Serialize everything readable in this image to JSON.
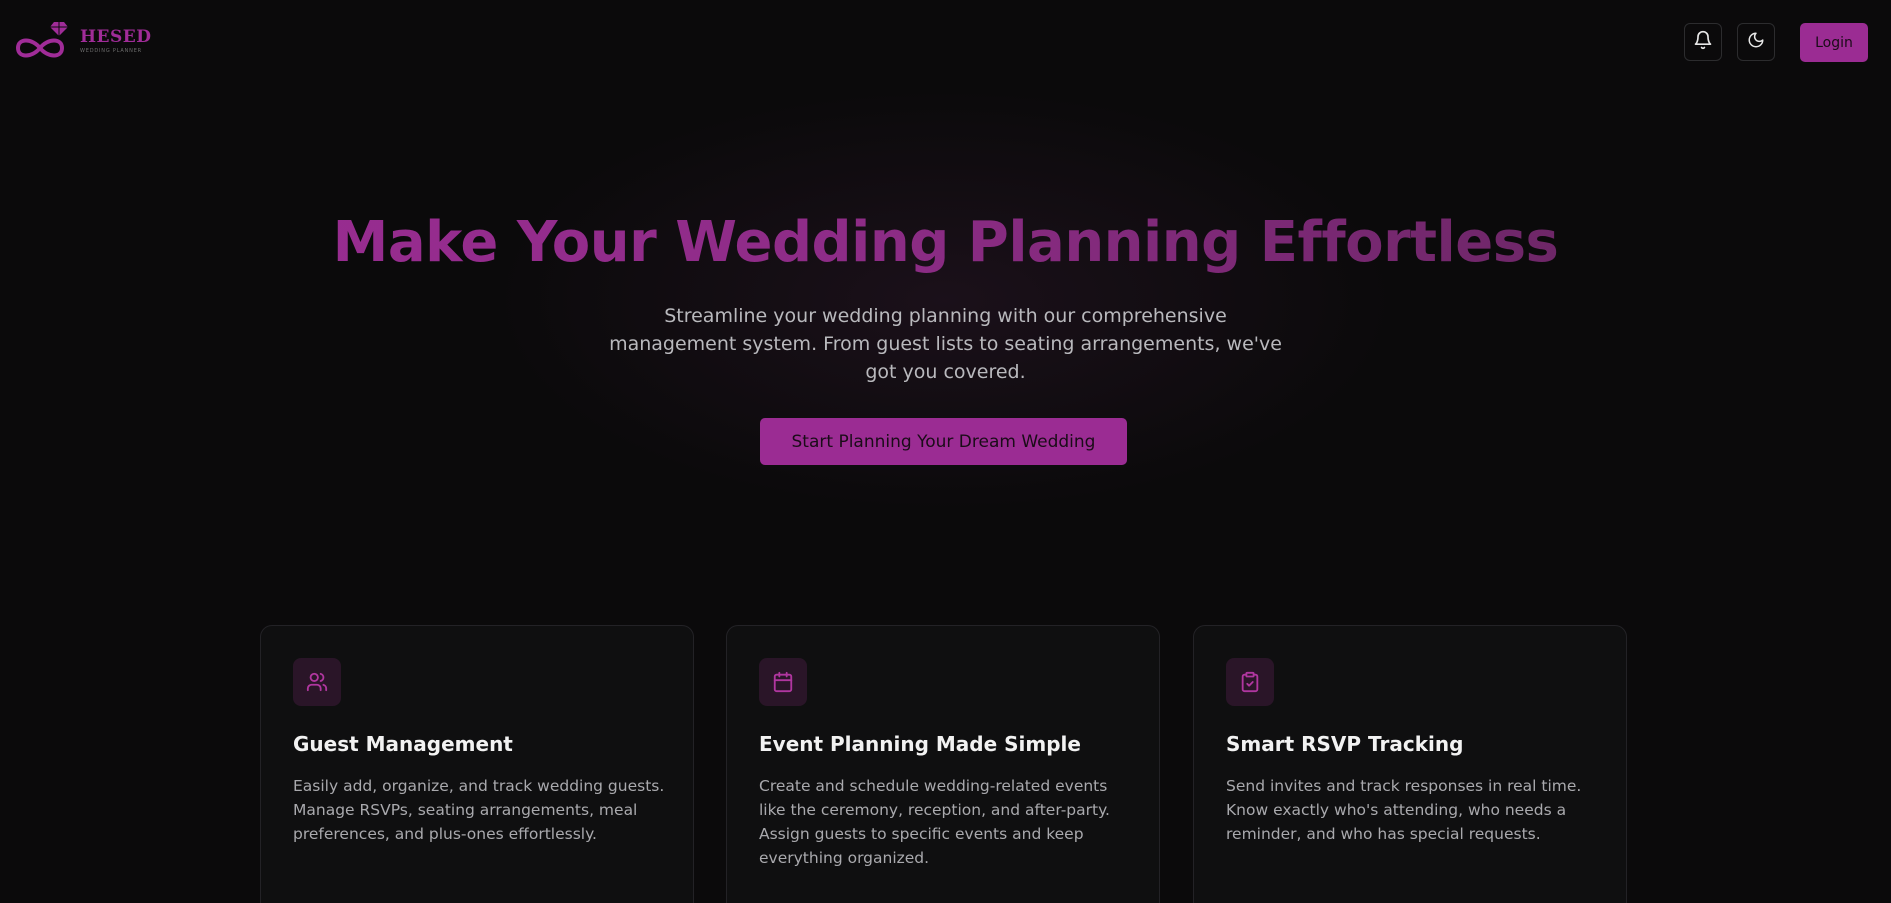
{
  "header": {
    "logo": {
      "name": "HESED",
      "tagline": "WEDDING PLANNER",
      "icon": "infinity-ring-icon"
    },
    "notification_icon": "bell-icon",
    "theme_icon": "moon-icon",
    "login_label": "Login"
  },
  "hero": {
    "title": "Make Your Wedding Planning Effortless",
    "subtitle": "Streamline your wedding planning with our comprehensive management system. From guest lists to seating arrangements, we've got you covered.",
    "cta_label": "Start Planning Your Dream Wedding"
  },
  "features": [
    {
      "icon": "users-icon",
      "title": "Guest Management",
      "description": "Easily add, organize, and track wedding guests. Manage RSVPs, seating arrangements, meal preferences, and plus-ones effortlessly."
    },
    {
      "icon": "calendar-icon",
      "title": "Event Planning Made Simple",
      "description": "Create and schedule wedding-related events like the ceremony, reception, and after-party. Assign guests to specific events and keep everything organized."
    },
    {
      "icon": "clipboard-check-icon",
      "title": "Smart RSVP Tracking",
      "description": "Send invites and track responses in real time. Know exactly who's attending, who needs a reminder, and who has special requests."
    }
  ],
  "colors": {
    "accent": "#9b2c93",
    "background": "#0b0a0b",
    "card_background": "#0f0f10",
    "icon_tile": "#2a1528"
  }
}
